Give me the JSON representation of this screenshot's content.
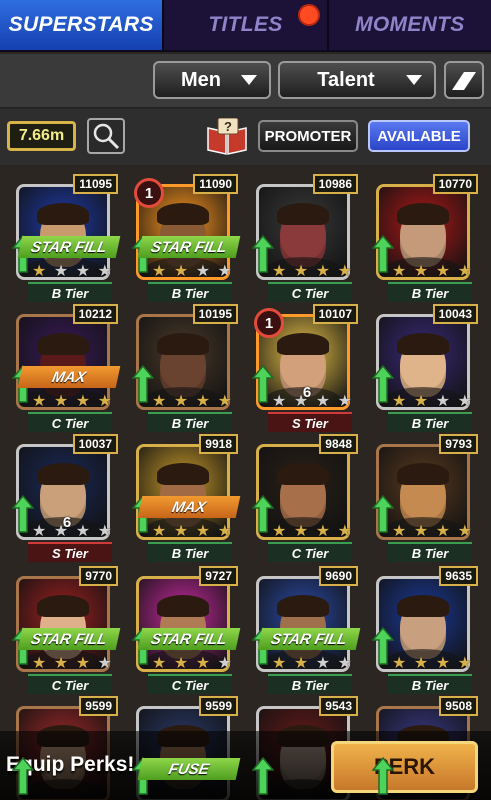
{
  "tabs": [
    {
      "label": "SUPERSTARS",
      "active": true
    },
    {
      "label": "TITLES",
      "active": false
    },
    {
      "label": "MOMENTS",
      "active": false
    }
  ],
  "filters": {
    "gender": "Men",
    "sort": "Talent"
  },
  "currency": "7.66m",
  "buttons": {
    "promoter": "PROMOTER",
    "available": "AVAILABLE",
    "perk": "PERK"
  },
  "bottom": {
    "equip_text": "Equip Perks!"
  },
  "colors": {
    "active_tab": "#2f6ee0",
    "notification": "#ff4b22",
    "gold": "#d7b04a",
    "available": "#3e5ce0",
    "perk": "#e9a03e"
  },
  "cards": [
    {
      "score": "11095",
      "tier": "B Tier",
      "stars": 4,
      "filled": 1,
      "banner": "STAR FILL",
      "frame": "silver",
      "bg": "#1f3aa8",
      "skin": "#c99a6e"
    },
    {
      "score": "11090",
      "tier": "B Tier",
      "stars": 4,
      "filled": 2,
      "banner": "STAR FILL",
      "frame": "orange",
      "rank": "1",
      "bg": "#ff9820",
      "skin": "#8a5a34"
    },
    {
      "score": "10986",
      "tier": "C Tier",
      "stars": 4,
      "filled": 4,
      "banner": "",
      "frame": "silver",
      "bg": "#3a3a3a",
      "skin": "#8a3a3a"
    },
    {
      "score": "10770",
      "tier": "B Tier",
      "stars": 4,
      "filled": 4,
      "banner": "",
      "frame": "gold",
      "bg": "#b01818",
      "skin": "#c49a7a"
    },
    {
      "score": "10212",
      "tier": "C Tier",
      "stars": 4,
      "filled": 4,
      "banner": "MAX",
      "frame": "bronze",
      "bg": "#3a1a5a",
      "skin": "#5a1a1a"
    },
    {
      "score": "10195",
      "tier": "B Tier",
      "stars": 4,
      "filled": 4,
      "banner": "",
      "frame": "bronze",
      "bg": "#4a3a2a",
      "skin": "#6a4230"
    },
    {
      "score": "10107",
      "tier": "S Tier",
      "stars": 4,
      "filled": 0,
      "banner": "",
      "frame": "orange",
      "rank": "1",
      "level": "6",
      "bg": "#e8c24a",
      "skin": "#d2a07a"
    },
    {
      "score": "10043",
      "tier": "B Tier",
      "stars": 4,
      "filled": 2,
      "banner": "",
      "frame": "silver",
      "bg": "#3a2a7a",
      "skin": "#e0b48a"
    },
    {
      "score": "10037",
      "tier": "S Tier",
      "stars": 4,
      "filled": 0,
      "banner": "",
      "frame": "silver",
      "level": "6",
      "bg": "#1a2a5a",
      "skin": "#c9a07a"
    },
    {
      "score": "9918",
      "tier": "B Tier",
      "stars": 4,
      "filled": 4,
      "banner": "MAX",
      "frame": "gold",
      "bg": "#c89a2a",
      "skin": "#a06a44"
    },
    {
      "score": "9848",
      "tier": "C Tier",
      "stars": 4,
      "filled": 4,
      "banner": "",
      "frame": "gold",
      "bg": "#2a2018",
      "skin": "#a8704a"
    },
    {
      "score": "9793",
      "tier": "B Tier",
      "stars": 4,
      "filled": 4,
      "banner": "",
      "frame": "bronze",
      "bg": "#5a3a20",
      "skin": "#c48a50"
    },
    {
      "score": "9770",
      "tier": "C Tier",
      "stars": 4,
      "filled": 3,
      "banner": "STAR FILL",
      "frame": "bronze",
      "bg": "#a02020",
      "skin": "#e0b08a"
    },
    {
      "score": "9727",
      "tier": "C Tier",
      "stars": 4,
      "filled": 3,
      "banner": "STAR FILL",
      "frame": "gold",
      "bg": "#c82aa0",
      "skin": "#b07a54"
    },
    {
      "score": "9690",
      "tier": "B Tier",
      "stars": 4,
      "filled": 2,
      "banner": "STAR FILL",
      "frame": "silver",
      "bg": "#2a4aa8",
      "skin": "#a0704c"
    },
    {
      "score": "9635",
      "tier": "B Tier",
      "stars": 4,
      "filled": 4,
      "banner": "",
      "frame": "silver",
      "bg": "#1a3a9a",
      "skin": "#c8a080"
    },
    {
      "score": "9599",
      "tier": "",
      "stars": 0,
      "filled": 0,
      "banner": "",
      "frame": "bronze",
      "bg": "#a02828",
      "skin": "#c8a080"
    },
    {
      "score": "9599",
      "tier": "",
      "stars": 0,
      "filled": 0,
      "banner": "FUSE",
      "frame": "silver",
      "bg": "#2a3a6a",
      "skin": "#a87a54"
    },
    {
      "score": "9543",
      "tier": "",
      "stars": 0,
      "filled": 0,
      "banner": "",
      "frame": "silver",
      "bg": "#6a1a1a",
      "skin": "#b09a8a"
    },
    {
      "score": "9508",
      "tier": "",
      "stars": 0,
      "filled": 0,
      "banner": "",
      "frame": "bronze",
      "bg": "#3a3a8a",
      "skin": "#c8a080"
    }
  ]
}
